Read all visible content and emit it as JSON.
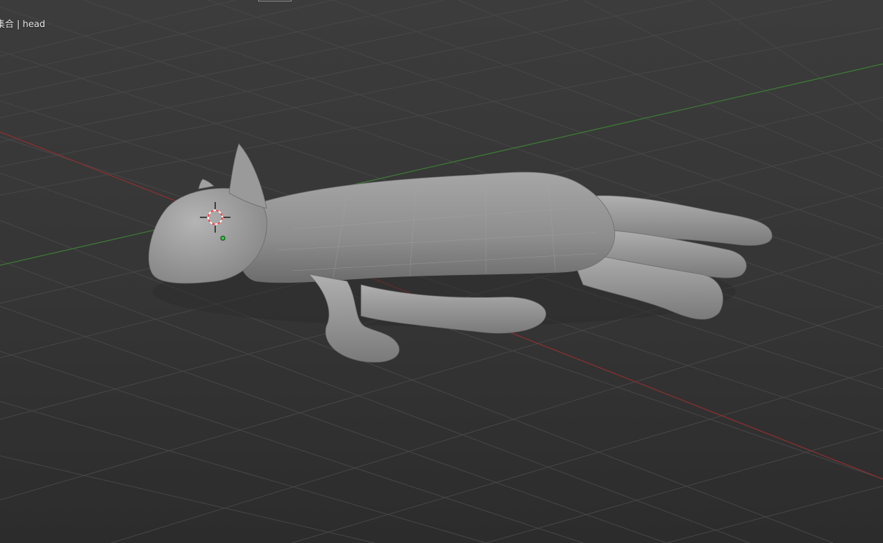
{
  "viewport": {
    "mode_label": ".",
    "collection_text": "集合 | head",
    "colors": {
      "background_top": "#3c3c3c",
      "background_bottom": "#2c2c2c",
      "grid_line": "#4a4a4a",
      "x_axis": "#8c2f2f",
      "y_axis": "#3d7a35",
      "mesh": "#8e8e8e",
      "cursor_red": "#ff3b3b",
      "origin_dot": "#2ecc40"
    },
    "icons": [
      "3d-cursor-icon",
      "origin-dot-icon"
    ],
    "object": "cat-mesh"
  }
}
